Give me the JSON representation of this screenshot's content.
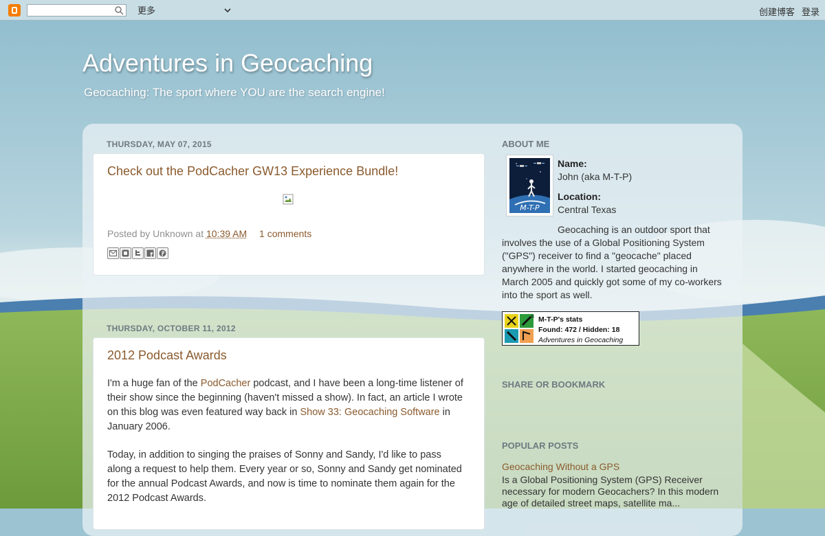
{
  "navbar": {
    "search_placeholder": "",
    "more_label": "更多",
    "create_blog": "创建博客",
    "login": "登录"
  },
  "header": {
    "title": "Adventures in Geocaching",
    "description": "Geocaching: The sport where YOU are the search engine!"
  },
  "posts": [
    {
      "date": "Thursday, May 07, 2015",
      "title": "Check out the PodCacher GW13 Experience Bundle!",
      "posted_by": "Posted by Unknown at",
      "time": "10:39 AM",
      "comments": "1 comments"
    },
    {
      "date": "Thursday, October 11, 2012",
      "title": "2012 Podcast Awards",
      "p1_a": "I'm a huge fan of the ",
      "p1_link1": "PodCacher",
      "p1_b": " podcast, and I have been a long-time listener of their show since the beginning (haven't missed a show).  In fact, an article I wrote on this blog was even featured way back in ",
      "p1_link2": "Show 33: Geocaching Software",
      "p1_c": " in January 2006.",
      "p2": "Today, in addition to singing the praises of Sonny and Sandy, I'd like to pass along a request to help them.  Every year or so, Sonny and Sandy get nominated for the annual Podcast Awards, and now is time to nominate them again for the 2012 Podcast Awards."
    }
  ],
  "sidebar": {
    "about_heading": "About Me",
    "name_label": "Name:",
    "name_value": "John (aka M-T-P)",
    "location_label": "Location:",
    "location_value": "Central Texas",
    "photo_caption": "M-T-P",
    "about_text": "Geocaching is an outdoor sport that involves the use of a Global Positioning System (\"GPS\") receiver to find a \"geocache\" placed anywhere in the world. I started geocaching in March 2005 and quickly got some of my co-workers into the sport as well.",
    "stats": {
      "title": "M-T-P's stats",
      "found_hidden": "Found: 472 / Hidden: 18",
      "blog": "Adventures in Geocaching",
      "registered": "®"
    },
    "share_heading": "Share or Bookmark",
    "popular_heading": "Popular Posts",
    "popular_title": "Geocaching Without a GPS",
    "popular_snippet": "Is a Global Positioning System (GPS) Receiver necessary for modern Geocachers? In this modern age of detailed street maps, satellite ma..."
  },
  "colors": {
    "link": "#8a5a2d",
    "sky": "#9cc3d2",
    "accent_orange": "#f57d00"
  }
}
